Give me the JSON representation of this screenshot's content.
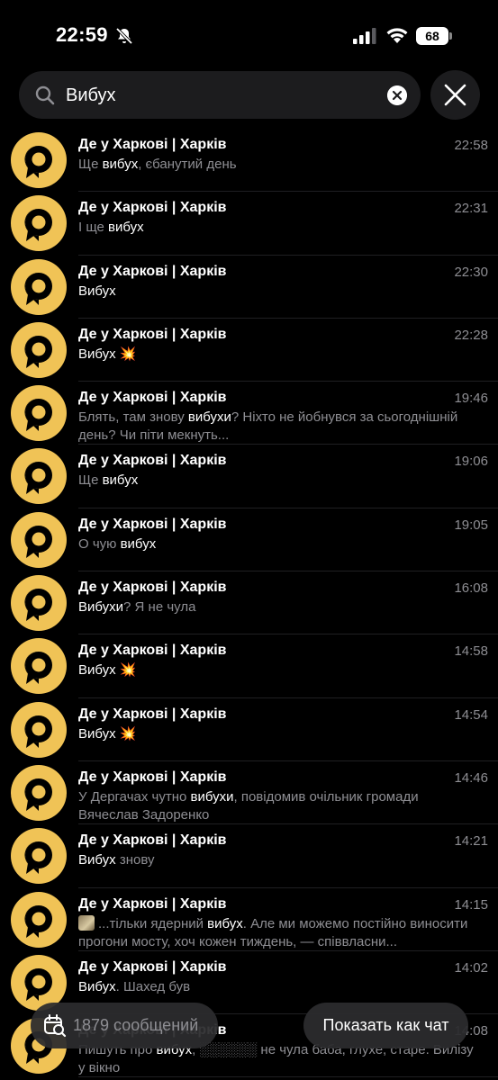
{
  "status_bar": {
    "time": "22:59",
    "battery": "68",
    "icons": [
      "bell-off-icon",
      "signal-icon",
      "wifi-icon",
      "battery-icon"
    ]
  },
  "search": {
    "value": "Вибух",
    "icons": [
      "search-icon",
      "clear-icon",
      "close-icon"
    ]
  },
  "colors": {
    "background": "#000000",
    "avatar": "#f0c356",
    "muted_text": "#8e8e93",
    "surface": "#1c1c1e"
  },
  "results": [
    {
      "title": "Де у Харкові | Харків",
      "time": "22:58",
      "parts": [
        [
          "Ще ",
          false
        ],
        [
          "вибух",
          true
        ],
        [
          ", єбанутий день",
          false
        ]
      ]
    },
    {
      "title": "Де у Харкові | Харків",
      "time": "22:31",
      "parts": [
        [
          "І ще ",
          false
        ],
        [
          "вибух",
          true
        ]
      ]
    },
    {
      "title": "Де у Харкові | Харків",
      "time": "22:30",
      "parts": [
        [
          "Вибух",
          true
        ]
      ]
    },
    {
      "title": "Де у Харкові | Харків",
      "time": "22:28",
      "parts": [
        [
          "Вибух",
          true
        ],
        [
          " 💥",
          false
        ]
      ]
    },
    {
      "title": "Де у Харкові | Харків",
      "time": "19:46",
      "parts": [
        [
          "Блять, там знову ",
          false
        ],
        [
          "вибухи",
          true
        ],
        [
          "? Ніхто не йобнувся за сьогоднішній день? Чи піти мекнуть...",
          false
        ]
      ]
    },
    {
      "title": "Де у Харкові | Харків",
      "time": "19:06",
      "parts": [
        [
          "Ще ",
          false
        ],
        [
          "вибух",
          true
        ]
      ]
    },
    {
      "title": "Де у Харкові | Харків",
      "time": "19:05",
      "parts": [
        [
          "О чую ",
          false
        ],
        [
          "вибух",
          true
        ]
      ]
    },
    {
      "title": "Де у Харкові | Харків",
      "time": "16:08",
      "parts": [
        [
          "Вибухи",
          true
        ],
        [
          "? Я не чула",
          false
        ]
      ]
    },
    {
      "title": "Де у Харкові | Харків",
      "time": "14:58",
      "parts": [
        [
          "Вибух",
          true
        ],
        [
          " 💥",
          false
        ]
      ]
    },
    {
      "title": "Де у Харкові | Харків",
      "time": "14:54",
      "parts": [
        [
          "Вибух",
          true
        ],
        [
          " 💥",
          false
        ]
      ]
    },
    {
      "title": "Де у Харкові | Харків",
      "time": "14:46",
      "parts": [
        [
          "У Дергачах чутно ",
          false
        ],
        [
          "вибухи",
          true
        ],
        [
          ", повідомив очільник громади Вячеслав Задоренко",
          false
        ]
      ]
    },
    {
      "title": "Де у Харкові | Харків",
      "time": "14:21",
      "parts": [
        [
          "Вибух",
          true
        ],
        [
          " знову",
          false
        ]
      ]
    },
    {
      "title": "Де у Харкові | Харків",
      "time": "14:15",
      "thumb": true,
      "parts": [
        [
          "...тільки ядерний ",
          false
        ],
        [
          "вибух",
          true
        ],
        [
          ". Але ми можемо постійно виносити прогони мосту, хоч кожен тиждень, — співвласни...",
          false
        ]
      ]
    },
    {
      "title": "Де у Харкові | Харків",
      "time": "14:02",
      "parts": [
        [
          "Вибух",
          true
        ],
        [
          ". Шахед був",
          false
        ]
      ]
    },
    {
      "title": "Де у Харкові | Харків",
      "time": "14:08",
      "parts": [
        [
          "Пишуть про ",
          false
        ],
        [
          "вибух",
          true
        ],
        [
          ", ░░░░░░ не чула баба, глухе, старе. Вилізу у вікно",
          false
        ]
      ]
    }
  ],
  "footer": {
    "count_label": "1879 сообщений",
    "view_as_chat_label": "Показать как чат",
    "icons": [
      "calendar-search-icon"
    ]
  }
}
